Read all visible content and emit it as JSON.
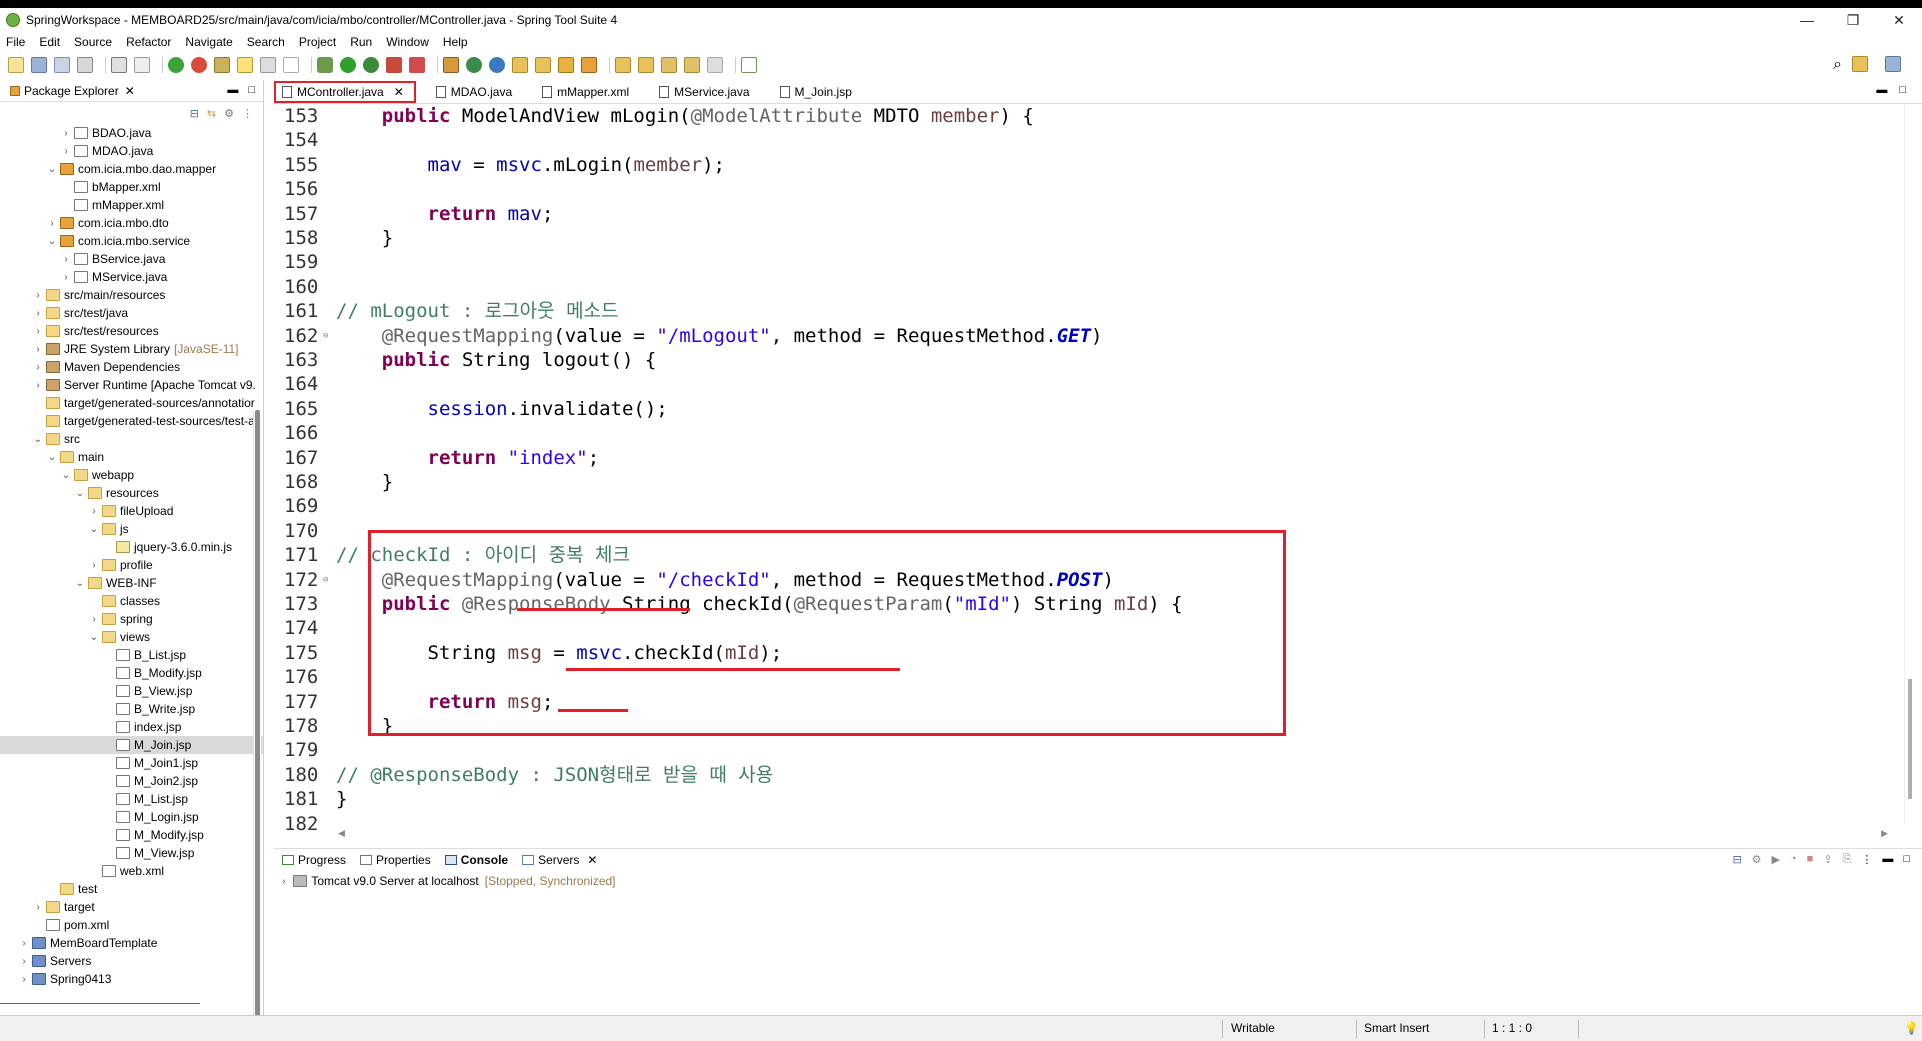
{
  "window": {
    "title": "SpringWorkspace - MEMBOARD25/src/main/java/com/icia/mbo/controller/MController.java - Spring Tool Suite 4",
    "minimize": "—",
    "maximize": "❐",
    "close": "✕"
  },
  "menu": [
    "File",
    "Edit",
    "Source",
    "Refactor",
    "Navigate",
    "Search",
    "Project",
    "Run",
    "Window",
    "Help"
  ],
  "package_explorer": {
    "title": "Package Explorer",
    "tree": [
      {
        "label": "BDAO.java",
        "indent": 4,
        "icon": "java",
        "arrow": "›"
      },
      {
        "label": "MDAO.java",
        "indent": 4,
        "icon": "java",
        "arrow": "›"
      },
      {
        "label": "com.icia.mbo.dao.mapper",
        "indent": 3,
        "icon": "pkg",
        "arrow": "⌄"
      },
      {
        "label": "bMapper.xml",
        "indent": 4,
        "icon": "xml",
        "arrow": ""
      },
      {
        "label": "mMapper.xml",
        "indent": 4,
        "icon": "xml",
        "arrow": ""
      },
      {
        "label": "com.icia.mbo.dto",
        "indent": 3,
        "icon": "pkg",
        "arrow": "›"
      },
      {
        "label": "com.icia.mbo.service",
        "indent": 3,
        "icon": "pkg",
        "arrow": "⌄"
      },
      {
        "label": "BService.java",
        "indent": 4,
        "icon": "java",
        "arrow": "›"
      },
      {
        "label": "MService.java",
        "indent": 4,
        "icon": "java",
        "arrow": "›"
      },
      {
        "label": "src/main/resources",
        "indent": 2,
        "icon": "folder",
        "arrow": "›"
      },
      {
        "label": "src/test/java",
        "indent": 2,
        "icon": "folder",
        "arrow": "›"
      },
      {
        "label": "src/test/resources",
        "indent": 2,
        "icon": "folder",
        "arrow": "›"
      },
      {
        "label": "JRE System Library",
        "decor": "[JavaSE-11]",
        "indent": 2,
        "icon": "lib",
        "arrow": "›"
      },
      {
        "label": "Maven Dependencies",
        "indent": 2,
        "icon": "lib",
        "arrow": "›"
      },
      {
        "label": "Server Runtime [Apache Tomcat v9.",
        "indent": 2,
        "icon": "lib",
        "arrow": "›"
      },
      {
        "label": "target/generated-sources/annotatior",
        "indent": 2,
        "icon": "folder",
        "arrow": ""
      },
      {
        "label": "target/generated-test-sources/test-ar",
        "indent": 2,
        "icon": "folder",
        "arrow": ""
      },
      {
        "label": "src",
        "indent": 2,
        "icon": "folder",
        "arrow": "⌄"
      },
      {
        "label": "main",
        "indent": 3,
        "icon": "folder",
        "arrow": "⌄"
      },
      {
        "label": "webapp",
        "indent": 4,
        "icon": "folder",
        "arrow": "⌄"
      },
      {
        "label": "resources",
        "indent": 5,
        "icon": "folder",
        "arrow": "⌄"
      },
      {
        "label": "fileUpload",
        "indent": 6,
        "icon": "folder",
        "arrow": "›"
      },
      {
        "label": "js",
        "indent": 6,
        "icon": "folder",
        "arrow": "⌄"
      },
      {
        "label": "jquery-3.6.0.min.js",
        "indent": 7,
        "icon": "js",
        "arrow": ""
      },
      {
        "label": "profile",
        "indent": 6,
        "icon": "folder",
        "arrow": "›"
      },
      {
        "label": "WEB-INF",
        "indent": 5,
        "icon": "folder",
        "arrow": "⌄"
      },
      {
        "label": "classes",
        "indent": 6,
        "icon": "folder",
        "arrow": ""
      },
      {
        "label": "spring",
        "indent": 6,
        "icon": "folder",
        "arrow": "›"
      },
      {
        "label": "views",
        "indent": 6,
        "icon": "folder",
        "arrow": "⌄"
      },
      {
        "label": "B_List.jsp",
        "indent": 7,
        "icon": "jsp",
        "arrow": ""
      },
      {
        "label": "B_Modify.jsp",
        "indent": 7,
        "icon": "jsp",
        "arrow": ""
      },
      {
        "label": "B_View.jsp",
        "indent": 7,
        "icon": "jsp",
        "arrow": ""
      },
      {
        "label": "B_Write.jsp",
        "indent": 7,
        "icon": "jsp",
        "arrow": ""
      },
      {
        "label": "index.jsp",
        "indent": 7,
        "icon": "jsp",
        "arrow": ""
      },
      {
        "label": "M_Join.jsp",
        "indent": 7,
        "icon": "jsp",
        "arrow": "",
        "selected": true
      },
      {
        "label": "M_Join1.jsp",
        "indent": 7,
        "icon": "jsp",
        "arrow": ""
      },
      {
        "label": "M_Join2.jsp",
        "indent": 7,
        "icon": "jsp",
        "arrow": ""
      },
      {
        "label": "M_List.jsp",
        "indent": 7,
        "icon": "jsp",
        "arrow": ""
      },
      {
        "label": "M_Login.jsp",
        "indent": 7,
        "icon": "jsp",
        "arrow": ""
      },
      {
        "label": "M_Modify.jsp",
        "indent": 7,
        "icon": "jsp",
        "arrow": ""
      },
      {
        "label": "M_View.jsp",
        "indent": 7,
        "icon": "jsp",
        "arrow": ""
      },
      {
        "label": "web.xml",
        "indent": 6,
        "icon": "xml",
        "arrow": ""
      },
      {
        "label": "test",
        "indent": 3,
        "icon": "folder",
        "arrow": ""
      },
      {
        "label": "target",
        "indent": 2,
        "icon": "folder",
        "arrow": "›"
      },
      {
        "label": "pom.xml",
        "indent": 2,
        "icon": "xml",
        "arrow": ""
      },
      {
        "label": "MemBoardTemplate",
        "indent": 1,
        "icon": "proj",
        "arrow": "›"
      },
      {
        "label": "Servers",
        "indent": 1,
        "icon": "proj",
        "arrow": "›"
      },
      {
        "label": "Spring0413",
        "indent": 1,
        "icon": "proj",
        "arrow": "›"
      }
    ]
  },
  "editor": {
    "tabs": [
      {
        "label": "MController.java",
        "active": true
      },
      {
        "label": "MDAO.java",
        "active": false
      },
      {
        "label": "mMapper.xml",
        "active": false
      },
      {
        "label": "MService.java",
        "active": false
      },
      {
        "label": "M_Join.jsp",
        "active": false
      }
    ],
    "lines": [
      {
        "n": "153",
        "html": "    <span class=\"kw\">public</span> ModelAndView mLogin(<span class=\"ann\">@ModelAttribute</span> MDTO <span class=\"var\">member</span>) {"
      },
      {
        "n": "154",
        "html": ""
      },
      {
        "n": "155",
        "html": "        <span class=\"fld\">mav</span> = <span class=\"fld\">msvc</span>.mLogin(<span class=\"var\">member</span>);"
      },
      {
        "n": "156",
        "html": ""
      },
      {
        "n": "157",
        "html": "        <span class=\"kw\">return</span> <span class=\"fld\">mav</span>;"
      },
      {
        "n": "158",
        "html": "    }"
      },
      {
        "n": "159",
        "html": ""
      },
      {
        "n": "160",
        "html": ""
      },
      {
        "n": "161",
        "html": "<span class=\"cmt\">// mLogout : 로그아웃 메소드</span>"
      },
      {
        "n": "162",
        "fold": true,
        "html": "    <span class=\"ann\">@RequestMapping</span>(value = <span class=\"str\">\"/mLogout\"</span>, method = RequestMethod.<span class=\"it\">GET</span>)"
      },
      {
        "n": "163",
        "html": "    <span class=\"kw\">public</span> String logout() {"
      },
      {
        "n": "164",
        "html": ""
      },
      {
        "n": "165",
        "html": "        <span class=\"fld\">session</span>.invalidate();"
      },
      {
        "n": "166",
        "html": ""
      },
      {
        "n": "167",
        "html": "        <span class=\"kw\">return</span> <span class=\"str\">\"index\"</span>;"
      },
      {
        "n": "168",
        "html": "    }"
      },
      {
        "n": "169",
        "html": ""
      },
      {
        "n": "170",
        "html": ""
      },
      {
        "n": "171",
        "html": "<span class=\"cmt\">// checkId : 아이디 중복 체크</span>"
      },
      {
        "n": "172",
        "fold": true,
        "html": "    <span class=\"ann\">@RequestMapping</span>(value = <span class=\"str\">\"/checkId\"</span>, method = RequestMethod.<span class=\"it\">POST</span>)"
      },
      {
        "n": "173",
        "html": "    <span class=\"kw\">public</span> <span class=\"ann\">@ResponseBody</span> String checkId(<span class=\"ann\">@RequestParam</span>(<span class=\"str\">\"mId\"</span>) String <span class=\"var\">mId</span>) {"
      },
      {
        "n": "174",
        "html": ""
      },
      {
        "n": "175",
        "html": "        String <span class=\"var\">msg</span> = <span class=\"fld\">msvc</span>.checkId(<span class=\"var\">mId</span>);"
      },
      {
        "n": "176",
        "html": ""
      },
      {
        "n": "177",
        "html": "        <span class=\"kw\">return</span> <span class=\"var\">msg</span>;"
      },
      {
        "n": "178",
        "html": "    }"
      },
      {
        "n": "179",
        "html": ""
      },
      {
        "n": "180",
        "html": "<span class=\"cmt\">// @ResponseBody : JSON형태로 받을 때 사용</span>"
      },
      {
        "n": "181",
        "html": "}"
      },
      {
        "n": "182",
        "html": ""
      }
    ]
  },
  "bottom_panel": {
    "tabs": [
      "Progress",
      "Properties",
      "Console",
      "Servers"
    ],
    "server": {
      "name": "Tomcat v9.0 Server at localhost",
      "status": "[Stopped, Synchronized]"
    }
  },
  "status_bar": {
    "mode": "Writable",
    "insert": "Smart Insert",
    "position": "1 : 1 : 0"
  },
  "colors": {
    "highlight_red": "#e1202c",
    "keyword": "#7f0055",
    "string": "#2a00ff",
    "comment": "#3f7f5f",
    "field": "#0000c0"
  }
}
